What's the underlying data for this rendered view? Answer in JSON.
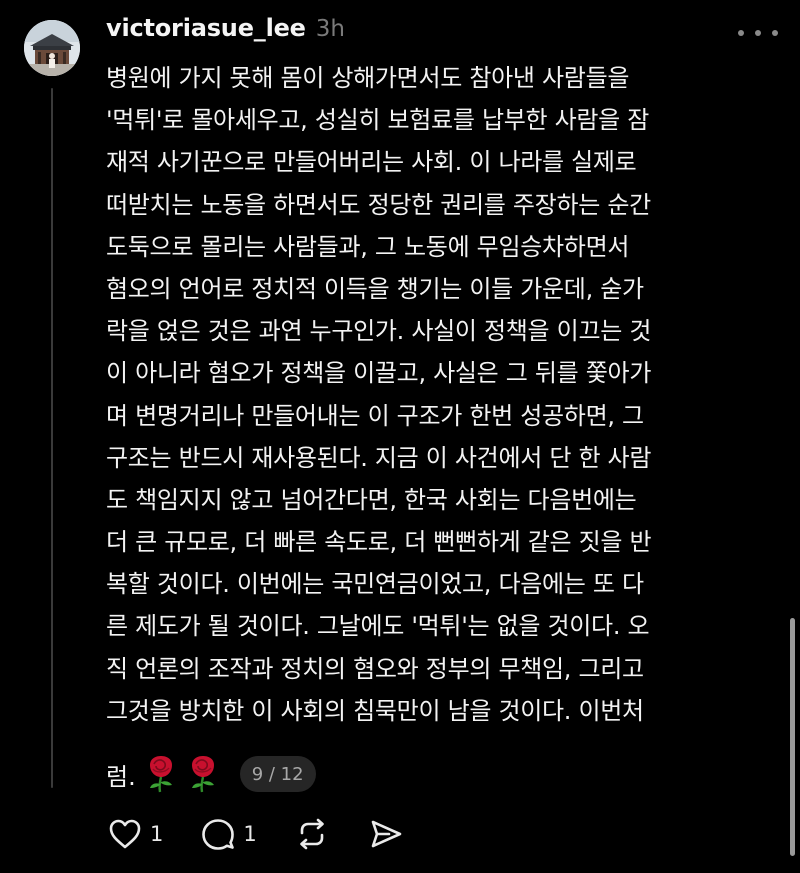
{
  "post": {
    "username": "victoriasue_lee",
    "time": "3h",
    "more_icon": "more-horizontal-icon",
    "body_lines": [
      "병원에 가지 못해 몸이 상해가면서도 참아낸 사람들을",
      "'먹튀'로 몰아세우고, 성실히 보험료를 납부한 사람을 잠",
      "재적 사기꾼으로 만들어버리는 사회. 이 나라를 실제로",
      "떠받치는 노동을 하면서도 정당한 권리를 주장하는 순간",
      "도둑으로 몰리는 사람들과, 그 노동에 무임승차하면서",
      "혐오의 언어로 정치적 이득을 챙기는 이들 가운데, 숟가",
      "락을 얹은 것은 과연 누구인가. 사실이 정책을 이끄는 것",
      "이 아니라 혐오가 정책을 이끌고, 사실은 그 뒤를 쫓아가",
      "며 변명거리나 만들어내는 이 구조가 한번 성공하면, 그",
      "구조는 반드시 재사용된다. 지금 이 사건에서 단 한 사람",
      "도 책임지지 않고 넘어간다면, 한국 사회는 다음번에는",
      "더 큰 규모로, 더 빠른 속도로, 더 뻔뻔하게 같은 짓을 반",
      "복할 것이다. 이번에는 국민연금이었고, 다음에는 또 다",
      "른 제도가 될 것이다. 그날에도 '먹튀'는 없을 것이다. 오",
      "직 언론의 조작과 정치의 혐오와 정부의 무책임, 그리고",
      "그것을 방치한 이 사회의 침묵만이 남을 것이다. 이번처"
    ],
    "last_line_text": "럼.",
    "emoji": [
      "rose-emoji",
      "rose-emoji"
    ],
    "page_badge": "9 / 12"
  },
  "actions": {
    "like": {
      "icon": "heart-icon",
      "count": "1"
    },
    "reply": {
      "icon": "comment-icon",
      "count": "1"
    },
    "repost": {
      "icon": "repost-icon"
    },
    "share": {
      "icon": "send-icon"
    }
  },
  "colors": {
    "background": "#000000",
    "text": "#f3f3f3",
    "muted": "#7a7a7a",
    "badge_bg": "#262626",
    "rose": "#c8102e"
  }
}
